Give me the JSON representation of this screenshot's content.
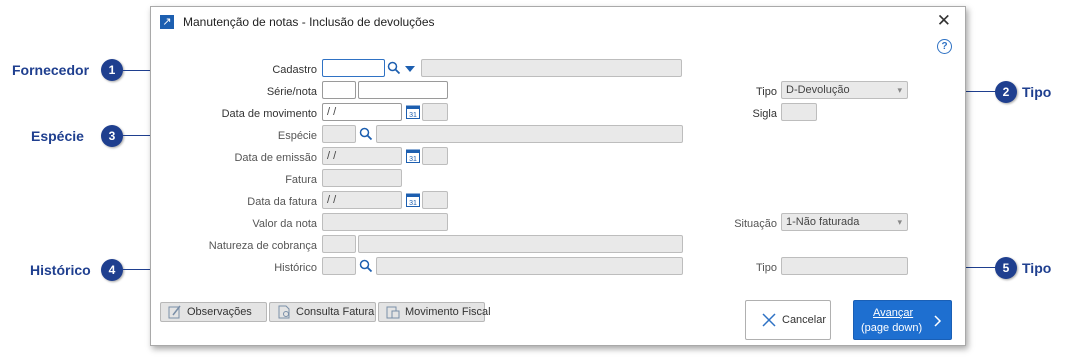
{
  "window": {
    "title": "Manutenção de notas - Inclusão de devoluções"
  },
  "callouts": [
    {
      "label": "Fornecedor",
      "number": "1"
    },
    {
      "label": "Tipo",
      "number": "2"
    },
    {
      "label": "Espécie",
      "number": "3"
    },
    {
      "label": "Histórico",
      "number": "4"
    },
    {
      "label": "Tipo",
      "number": "5"
    }
  ],
  "form": {
    "cadastro_label": "Cadastro",
    "serie_label": "Série/nota",
    "data_movimento_label": "Data de movimento",
    "data_movimento_value": " / /",
    "especie_label": "Espécie",
    "data_emissao_label": "Data de emissão",
    "data_emissao_value": " / /",
    "fatura_label": "Fatura",
    "data_fatura_label": "Data da fatura",
    "data_fatura_value": " / /",
    "valor_nota_label": "Valor da nota",
    "natureza_label": "Natureza de cobrança",
    "historico_label": "Histórico",
    "tipo_label": "Tipo",
    "tipo_value": "D-Devolução",
    "sigla_label": "Sigla",
    "situacao_label": "Situação",
    "situacao_value": "1-Não faturada",
    "tipo2_label": "Tipo"
  },
  "buttons": {
    "observacoes": "Observações",
    "consulta_fatura": "Consulta Fatura",
    "movimento_fiscal": "Movimento Fiscal",
    "cancelar": "Cancelar",
    "avancar": "Avançar",
    "avancar_sub": "(page down)"
  },
  "colors": {
    "callout": "#1f3f8f",
    "accent": "#1e6fd0"
  },
  "icons": [
    "window-icon",
    "close-icon",
    "help-icon",
    "search-icon",
    "dropdown-arrow-icon",
    "calendar-icon",
    "observations-icon",
    "invoice-icon",
    "fiscal-icon",
    "x-icon",
    "chevron-right-icon"
  ]
}
